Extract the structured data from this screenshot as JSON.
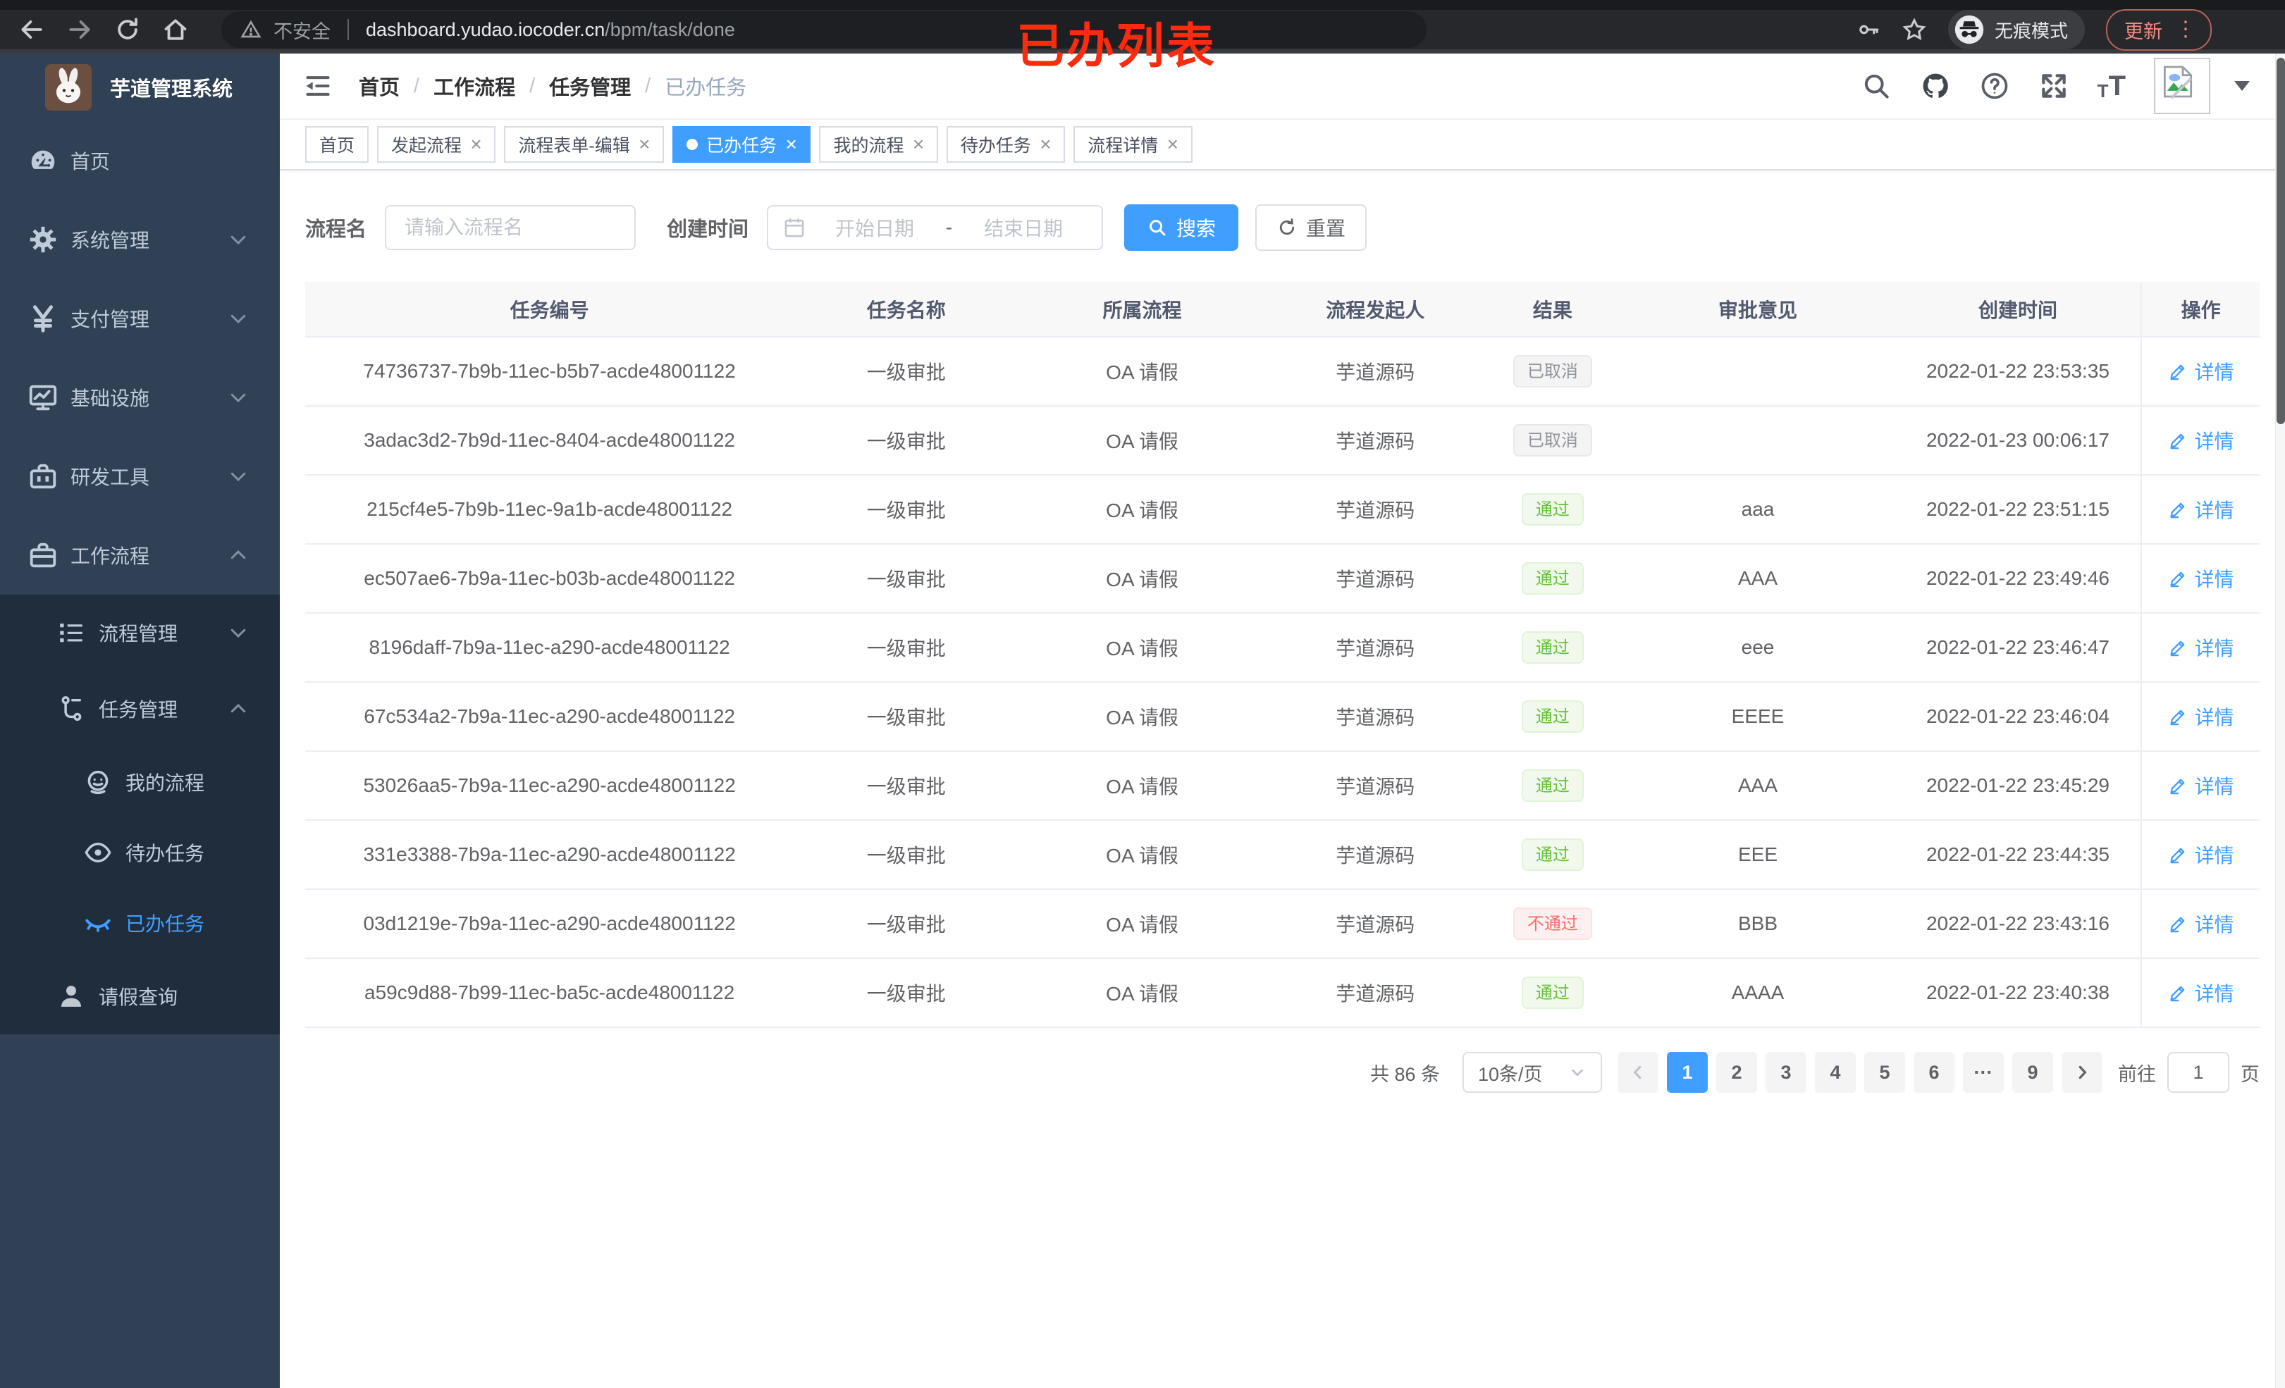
{
  "browser": {
    "security_label": "不安全",
    "url_domain": "dashboard.yudao.iocoder.cn",
    "url_path": "/bpm/task/done",
    "incognito_label": "无痕模式",
    "update_label": "更新",
    "more_dots": "⋮"
  },
  "annotation": {
    "text": "已办列表",
    "color": "#fb2b10"
  },
  "sidebar": {
    "title": "芋道管理系统",
    "items": [
      {
        "label": "首页"
      },
      {
        "label": "系统管理"
      },
      {
        "label": "支付管理"
      },
      {
        "label": "基础设施"
      },
      {
        "label": "研发工具"
      },
      {
        "label": "工作流程"
      },
      {
        "label": "流程管理"
      },
      {
        "label": "任务管理"
      },
      {
        "label": "我的流程"
      },
      {
        "label": "待办任务"
      },
      {
        "label": "已办任务"
      },
      {
        "label": "请假查询"
      }
    ]
  },
  "header": {
    "breadcrumb": [
      "首页",
      "工作流程",
      "任务管理",
      "已办任务"
    ],
    "separator": "/"
  },
  "tabs": [
    {
      "label": "首页",
      "classes": ""
    },
    {
      "label": "发起流程",
      "classes": "closable"
    },
    {
      "label": "流程表单-编辑",
      "classes": "closable"
    },
    {
      "label": "已办任务",
      "classes": "active closable"
    },
    {
      "label": "我的流程",
      "classes": "closable"
    },
    {
      "label": "待办任务",
      "classes": "closable"
    },
    {
      "label": "流程详情",
      "classes": "closable"
    }
  ],
  "filter": {
    "name_label": "流程名",
    "name_placeholder": "请输入流程名",
    "time_label": "创建时间",
    "start_placeholder": "开始日期",
    "range_separator": "-",
    "end_placeholder": "结束日期",
    "search_label": "搜索",
    "reset_label": "重置"
  },
  "table": {
    "columns": [
      "任务编号",
      "任务名称",
      "所属流程",
      "流程发起人",
      "结果",
      "审批意见",
      "创建时间",
      "操作"
    ],
    "action_label": "详情",
    "rows": [
      {
        "id": "74736737-7b9b-11ec-b5b7-acde48001122",
        "name": "一级审批",
        "process": "OA 请假",
        "starter": "芋道源码",
        "result": "已取消",
        "result_class": "info",
        "comment": "",
        "created": "2022-01-22 23:53:35"
      },
      {
        "id": "3adac3d2-7b9d-11ec-8404-acde48001122",
        "name": "一级审批",
        "process": "OA 请假",
        "starter": "芋道源码",
        "result": "已取消",
        "result_class": "info",
        "comment": "",
        "created": "2022-01-23 00:06:17"
      },
      {
        "id": "215cf4e5-7b9b-11ec-9a1b-acde48001122",
        "name": "一级审批",
        "process": "OA 请假",
        "starter": "芋道源码",
        "result": "通过",
        "result_class": "success",
        "comment": "aaa",
        "created": "2022-01-22 23:51:15"
      },
      {
        "id": "ec507ae6-7b9a-11ec-b03b-acde48001122",
        "name": "一级审批",
        "process": "OA 请假",
        "starter": "芋道源码",
        "result": "通过",
        "result_class": "success",
        "comment": "AAA",
        "created": "2022-01-22 23:49:46"
      },
      {
        "id": "8196daff-7b9a-11ec-a290-acde48001122",
        "name": "一级审批",
        "process": "OA 请假",
        "starter": "芋道源码",
        "result": "通过",
        "result_class": "success",
        "comment": "eee",
        "created": "2022-01-22 23:46:47"
      },
      {
        "id": "67c534a2-7b9a-11ec-a290-acde48001122",
        "name": "一级审批",
        "process": "OA 请假",
        "starter": "芋道源码",
        "result": "通过",
        "result_class": "success",
        "comment": "EEEE",
        "created": "2022-01-22 23:46:04"
      },
      {
        "id": "53026aa5-7b9a-11ec-a290-acde48001122",
        "name": "一级审批",
        "process": "OA 请假",
        "starter": "芋道源码",
        "result": "通过",
        "result_class": "success",
        "comment": "AAA",
        "created": "2022-01-22 23:45:29"
      },
      {
        "id": "331e3388-7b9a-11ec-a290-acde48001122",
        "name": "一级审批",
        "process": "OA 请假",
        "starter": "芋道源码",
        "result": "通过",
        "result_class": "success",
        "comment": "EEE",
        "created": "2022-01-22 23:44:35"
      },
      {
        "id": "03d1219e-7b9a-11ec-a290-acde48001122",
        "name": "一级审批",
        "process": "OA 请假",
        "starter": "芋道源码",
        "result": "不通过",
        "result_class": "danger",
        "comment": "BBB",
        "created": "2022-01-22 23:43:16"
      },
      {
        "id": "a59c9d88-7b99-11ec-ba5c-acde48001122",
        "name": "一级审批",
        "process": "OA 请假",
        "starter": "芋道源码",
        "result": "通过",
        "result_class": "success",
        "comment": "AAAA",
        "created": "2022-01-22 23:40:38"
      }
    ]
  },
  "pagination": {
    "total": "共 86 条",
    "page_size": "10条/页",
    "pages": [
      {
        "label": "1",
        "classes": "active"
      },
      {
        "label": "2",
        "classes": ""
      },
      {
        "label": "3",
        "classes": ""
      },
      {
        "label": "4",
        "classes": ""
      },
      {
        "label": "5",
        "classes": ""
      },
      {
        "label": "6",
        "classes": ""
      },
      {
        "label": "···",
        "classes": "more"
      },
      {
        "label": "9",
        "classes": ""
      }
    ],
    "goto_label": "前往",
    "goto_value": "1",
    "goto_suffix": "页"
  },
  "colors": {
    "primary": "#409eff",
    "success": "#67c23a",
    "danger": "#f56c6c",
    "info": "#909399",
    "sidebar_bg": "#304156",
    "submenu_bg": "#1f2d3d",
    "annotation_red": "#fb2b10"
  }
}
